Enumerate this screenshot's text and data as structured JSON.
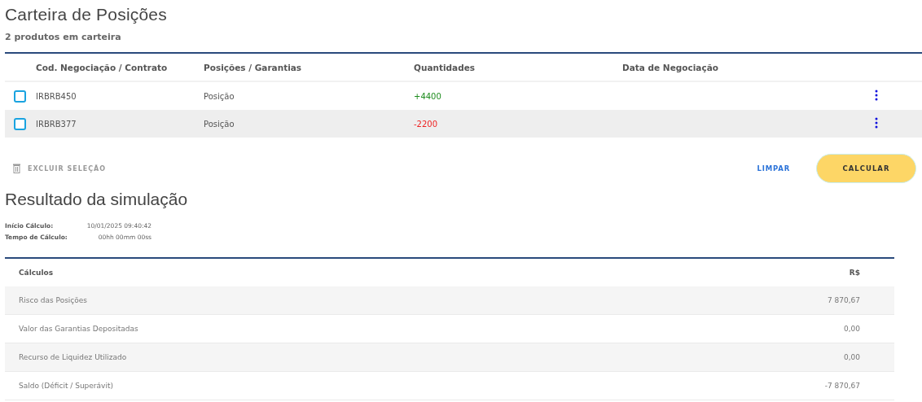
{
  "header": {
    "title": "Carteira de Posições",
    "subtitle": "2 produtos em carteira"
  },
  "portfolio": {
    "columns": [
      "Cod. Negociação / Contrato",
      "Posições / Garantias",
      "Quantidades",
      "Data de Negociação"
    ],
    "rows": [
      {
        "checked": false,
        "code": "IRBRB450",
        "type": "Posição",
        "quantity": "+4400",
        "color": "#1e8c1e"
      },
      {
        "checked": false,
        "code": "IRBRB377",
        "type": "Posição",
        "quantity": "-2200",
        "color": "#ee2222"
      }
    ]
  },
  "actions": {
    "delete": {
      "label": "EXCLUIR SELEÇÃO",
      "disabled": true
    },
    "clear": "LIMPAR",
    "calculate": "CALCULAR"
  },
  "result": {
    "title": "Resultado da simulação",
    "info": [
      {
        "label": "Início Cálculo:",
        "value": "10/01/2025 09:40:42"
      },
      {
        "label": "Tempo de Cálculo:",
        "value": "00hh 00mm 00ss"
      }
    ],
    "columns": [
      "Cálculos",
      "R$"
    ],
    "rows": [
      {
        "label": "Risco das Posições",
        "value": "7 870,67"
      },
      {
        "label": "Valor das Garantias Depositadas",
        "value": "0,00"
      },
      {
        "label": "Recurso de Liquidez Utilizado",
        "value": "0,00"
      },
      {
        "label": "Saldo (Déficit / Superávit)",
        "value": "-7 870,67"
      }
    ]
  }
}
